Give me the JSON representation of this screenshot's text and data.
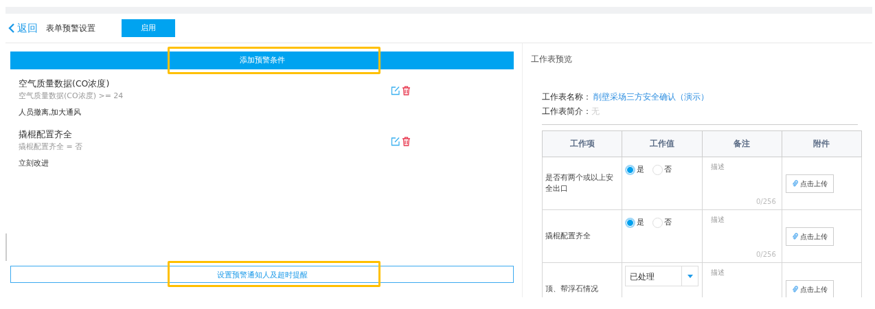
{
  "header": {
    "back": "返回",
    "title": "表单预警设置",
    "enable_button": "启用"
  },
  "add_condition_button": {
    "label": "添加预警条件",
    "highlighted": true
  },
  "conditions": [
    {
      "name": "空气质量数据(CO浓度)",
      "rule": "空气质量数据(CO浓度) >= 24",
      "action": "人员撤离,加大通风"
    },
    {
      "name": "撬棍配置齐全",
      "rule": "撬棍配置齐全 = 否",
      "action": "立刻改进"
    }
  ],
  "notify_button": {
    "label": "设置预警通知人及超时提醒",
    "highlighted": true
  },
  "preview": {
    "title": "工作表预览",
    "name_label": "工作表名称：",
    "name": "削壁采场三方安全确认（演示）",
    "intro_label": "工作表简介：",
    "intro": "无",
    "columns": [
      "工作项",
      "工作值",
      "备注",
      "附件"
    ],
    "rows": [
      {
        "item": "是否有两个或以上安全出口",
        "kind": "radio",
        "options": [
          {
            "label": "是",
            "selected": true
          },
          {
            "label": "否",
            "selected": false
          }
        ],
        "remark_placeholder": "描述",
        "counter": "0/256",
        "upload": "点击上传"
      },
      {
        "item": "撬棍配置齐全",
        "kind": "radio",
        "options": [
          {
            "label": "是",
            "selected": true
          },
          {
            "label": "否",
            "selected": false
          }
        ],
        "remark_placeholder": "描述",
        "counter": "0/256",
        "upload": "点击上传"
      },
      {
        "item": "顶、帮浮石情况",
        "kind": "select",
        "value": "已处理",
        "remark_placeholder": "描述",
        "upload": "点击上传"
      }
    ]
  }
}
